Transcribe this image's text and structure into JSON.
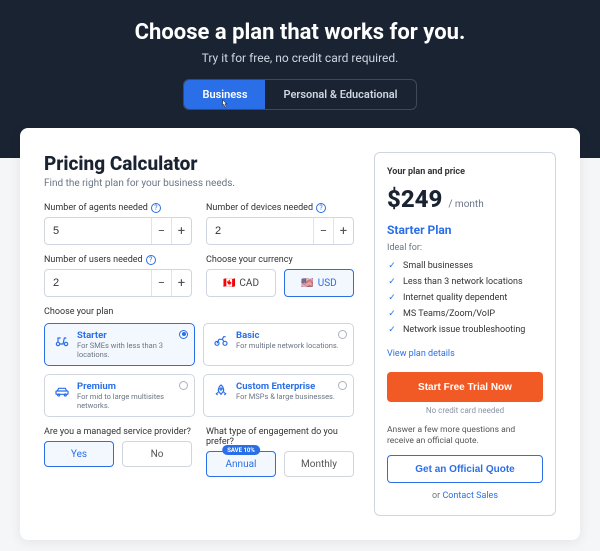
{
  "hero": {
    "title": "Choose a plan that works for you.",
    "subtitle": "Try it for free, no credit card required.",
    "tab_business": "Business",
    "tab_personal": "Personal & Educational"
  },
  "calc": {
    "heading": "Pricing Calculator",
    "sub": "Find the right plan for your business needs.",
    "agents_label": "Number of agents needed",
    "agents_value": "5",
    "devices_label": "Number of devices needed",
    "devices_value": "2",
    "users_label": "Number of users needed",
    "users_value": "2",
    "currency_label": "Choose your currency",
    "currency_cad": "CAD",
    "currency_usd": "USD",
    "plan_label": "Choose your plan",
    "msp_label": "Are you a managed service provider?",
    "msp_yes": "Yes",
    "msp_no": "No",
    "engage_label": "What type of engagement do you prefer?",
    "engage_annual": "Annual",
    "engage_monthly": "Monthly",
    "save_badge": "SAVE 10%"
  },
  "plans": {
    "starter": {
      "name": "Starter",
      "desc": "For SMEs with less than 3 locations."
    },
    "basic": {
      "name": "Basic",
      "desc": "For multiple network locations."
    },
    "premium": {
      "name": "Premium",
      "desc": "For mid to large multisites networks."
    },
    "custom": {
      "name": "Custom Enterprise",
      "desc": "For MSPs & large businesses."
    }
  },
  "summary": {
    "your_plan_label": "Your plan and price",
    "price": "$249",
    "per": "/ month",
    "tier_name": "Starter Plan",
    "ideal_label": "Ideal for:",
    "features": [
      "Small businesses",
      "Less than 3 network locations",
      "Internet quality dependent",
      "MS Teams/Zoom/VoIP",
      "Network issue troubleshooting"
    ],
    "details_link": "View plan details",
    "cta": "Start Free Trial Now",
    "no_cc": "No credit card needed",
    "answer_more": "Answer a few more questions and receive an official quote.",
    "quote_btn": "Get an Official Quote",
    "or": "or ",
    "contact": "Contact Sales"
  }
}
